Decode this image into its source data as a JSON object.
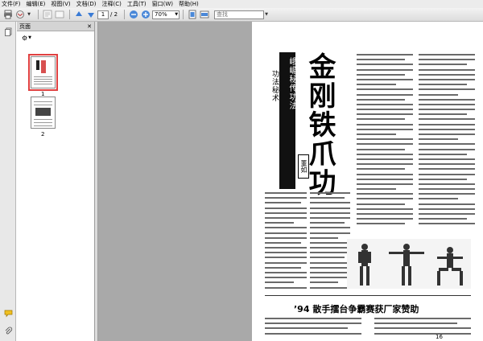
{
  "menubar": {
    "items": [
      "文件(F)",
      "编辑(E)",
      "视图(V)",
      "文档(D)",
      "注释(C)",
      "工具(T)",
      "窗口(W)",
      "帮助(H)"
    ]
  },
  "toolbar": {
    "current_page": "1",
    "total_pages": "/ 2",
    "zoom": "70%",
    "find_placeholder": "查找"
  },
  "panel": {
    "title": "页面",
    "close_glyph": "✕",
    "thumbnails": [
      {
        "label": "1",
        "selected": true
      },
      {
        "label": "2",
        "selected": false
      }
    ]
  },
  "document": {
    "title_main": "金刚铁爪功",
    "title_sub": "峨嵋秘传功法",
    "title_side": "功法秘术",
    "author": "董如",
    "headline": "’94 散手擂台争霸赛获厂家赞助",
    "page_number": "16"
  },
  "icons": {
    "print": "print-icon",
    "email": "email-icon",
    "page_up": "arrow-up-icon",
    "page_down": "arrow-down-icon",
    "zoom_out": "zoom-out-icon",
    "zoom_in": "zoom-in-icon",
    "pages_panel": "pages-icon",
    "attachments": "paperclip-icon",
    "comments": "comment-icon"
  },
  "colors": {
    "selected_thumb": "#e04040",
    "doc_background": "#a9a9a9"
  }
}
